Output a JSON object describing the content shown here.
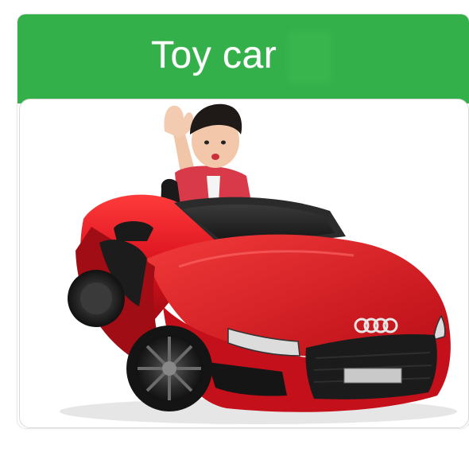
{
  "card": {
    "title": "Toy car",
    "header_color": "#34b04a"
  },
  "photo": {
    "car_color": "#d8101c"
  }
}
